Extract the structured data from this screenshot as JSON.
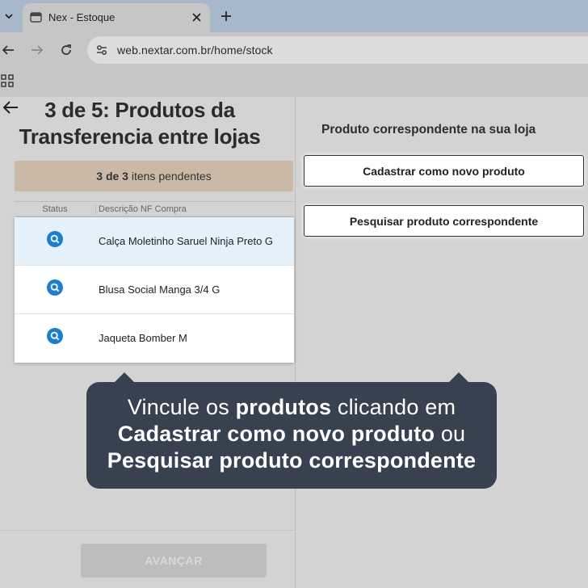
{
  "browser": {
    "tab_title": "Nex - Estoque",
    "url": "web.nextar.com.br/home/stock",
    "icons": [
      "chevron-down-icon",
      "favicon-icon",
      "close-icon",
      "plus-icon",
      "back-icon",
      "forward-icon",
      "reload-icon",
      "site-info-icon",
      "apps-icon"
    ]
  },
  "left": {
    "title": "3 de 5: Produtos da Transferencia entre lojas",
    "pending": {
      "count": "3 de 3",
      "suffix": "itens pendentes"
    },
    "table": {
      "headers": [
        "Status",
        "Descrição NF Compra"
      ],
      "rows": [
        {
          "status_icon": "search-icon",
          "description": "Calça Moletinho Saruel Ninja Preto G",
          "selected": true
        },
        {
          "status_icon": "search-icon",
          "description": "Blusa Social Manga 3/4 G",
          "selected": false
        },
        {
          "status_icon": "search-icon",
          "description": "Jaqueta Bomber M",
          "selected": false
        }
      ]
    },
    "advance_label": "AVANÇAR"
  },
  "right": {
    "title": "Produto correspondente na sua loja",
    "btn_new": "Cadastrar como novo produto",
    "btn_search": "Pesquisar produto correspondente"
  },
  "tooltip": {
    "p1": "Vincule os ",
    "b1": "produtos",
    "p2": " clicando em",
    "b2": "Cadastrar como novo produto",
    "p3": " ou",
    "b3": "Pesquisar produto correspondente"
  },
  "colors": {
    "accent_blue": "#1a7fd0",
    "tooltip_bg": "#374150",
    "pending_bg": "#c9b9a6"
  }
}
